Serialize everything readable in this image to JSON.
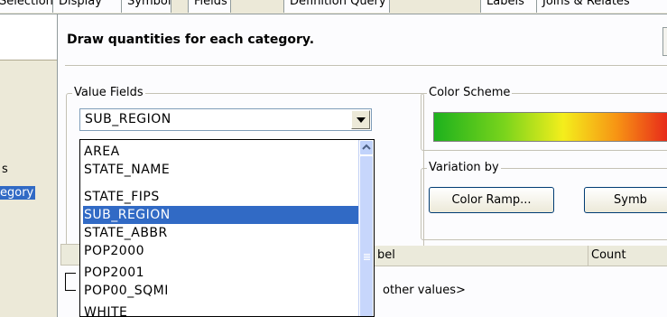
{
  "tabs": [
    {
      "label": "Selection"
    },
    {
      "label": "Display"
    },
    {
      "label": "Symbology"
    },
    {
      "label": "Fields"
    },
    {
      "label": "Definition Query"
    },
    {
      "label": "Labels"
    },
    {
      "label": "Joins & Relates"
    }
  ],
  "left_panel": {
    "items": [
      {
        "label": "s"
      },
      {
        "label": "egory"
      }
    ]
  },
  "heading": "Draw quantities for each category.",
  "value_fields": {
    "group_label": "Value Fields",
    "selected": "SUB_REGION",
    "options": [
      "AREA",
      "STATE_NAME",
      "STATE_FIPS",
      "SUB_REGION",
      "STATE_ABBR",
      "POP2000",
      "POP2001",
      "POP00_SQMI",
      "WHITE"
    ],
    "selected_index": 3
  },
  "color_scheme": {
    "group_label": "Color Scheme",
    "ramp_colors": [
      "#1db11d",
      "#7ad41c",
      "#f4ee1c",
      "#f79314",
      "#e7271a"
    ]
  },
  "variation": {
    "group_label": "Variation by",
    "color_ramp_button": "Color Ramp...",
    "symbol_button": "Symb"
  },
  "table": {
    "columns": [
      "bel",
      "Count"
    ],
    "rows": [
      {
        "label": "other values>"
      }
    ]
  }
}
